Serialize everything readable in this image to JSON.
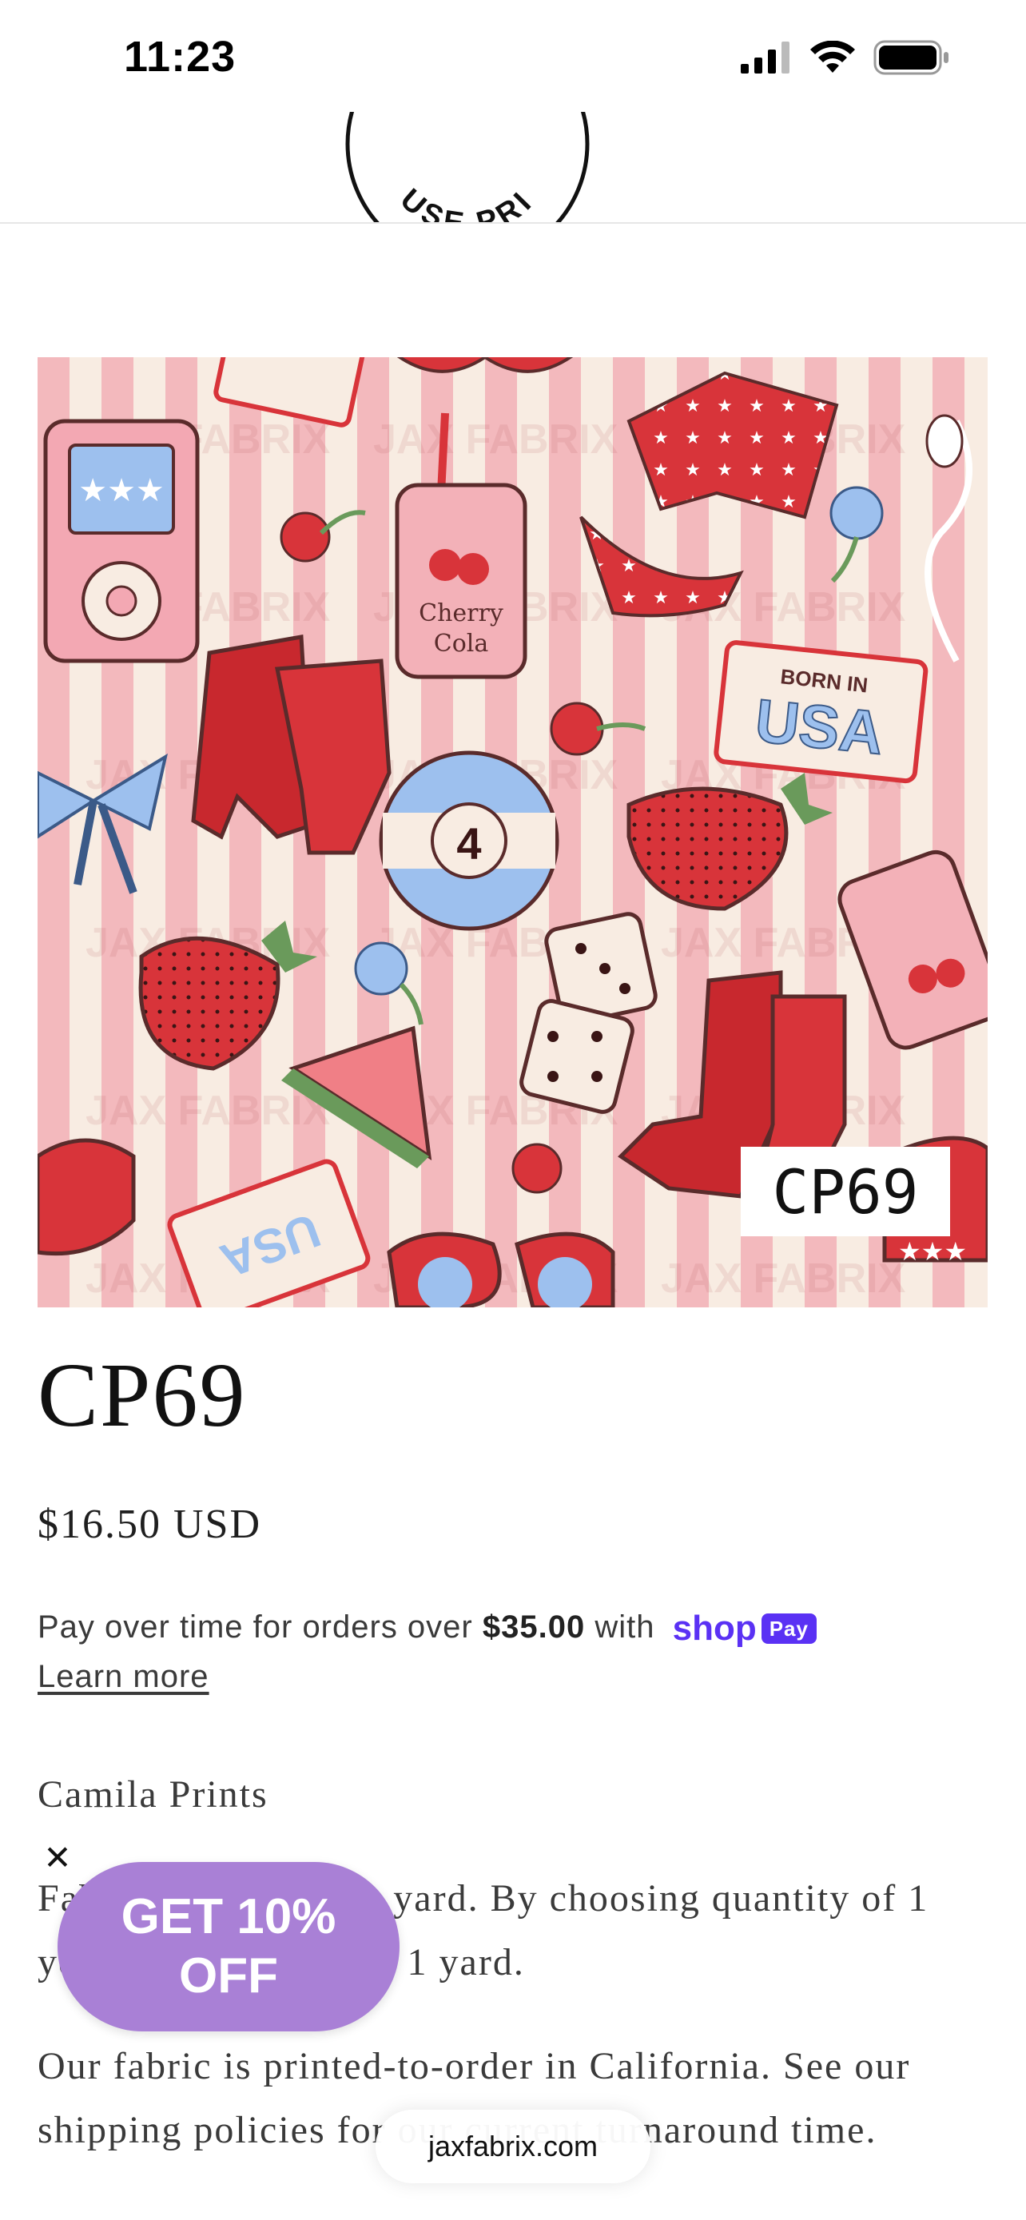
{
  "status_bar": {
    "time": "11:23",
    "icons": [
      "cellular-signal-icon",
      "wifi-icon",
      "battery-icon"
    ]
  },
  "header": {
    "logo_partial_text": "USE PRI",
    "logo_icon": "brand-logo-seal"
  },
  "product": {
    "image_watermark": "JAX FABRIX",
    "image_label": "CP69",
    "title": "CP69",
    "price": "$16.50 USD",
    "installment": {
      "prefix": "Pay over time for orders over",
      "amount": "$35.00",
      "suffix": "with",
      "provider_word": "shop",
      "provider_badge": "Pay",
      "learn_more": "Learn more"
    },
    "vendor": "Camila Prints",
    "description_1": "Fabric is sold by the yard. By choosing quantity of 1 you will be receiving 1 yard.",
    "description_2": "Our fabric is printed-to-order in California. See our shipping policies for our current turnaround time."
  },
  "promo": {
    "close_icon": "close-icon",
    "line1": "GET 10%",
    "line2": "OFF"
  },
  "browser": {
    "url": "jaxfabrix.com"
  },
  "colors": {
    "promo_bg": "#a980d6",
    "shop_pay": "#5a31f4",
    "stripe_pink": "#f3b9bd",
    "stripe_cream": "#f8ece2",
    "motif_red": "#d8343a",
    "motif_blue": "#9dc0ee"
  }
}
